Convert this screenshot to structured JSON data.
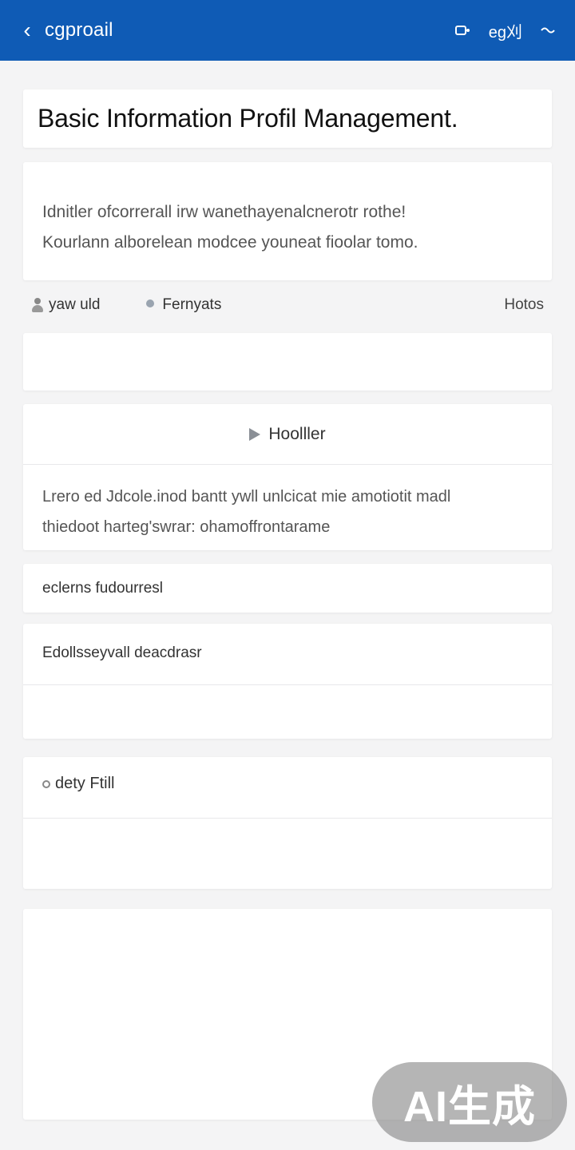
{
  "header": {
    "title": "cgproail",
    "action_label": "eg刈",
    "colors": {
      "background": "#0f5bb5",
      "text": "#ffffff"
    }
  },
  "page_title": "Basic Information Profil Management.",
  "intro": {
    "line1": "Idnitler ofcorrerall irw wanethayenalcnerotr rothe!",
    "line2": "Kourlann alborelean modcee youneat fioolar tomo."
  },
  "tabs": {
    "items": [
      {
        "label": "yaw uld",
        "icon": "person-icon"
      },
      {
        "label": "Fernyats",
        "icon": "dot-icon"
      }
    ],
    "right_label": "Hotos"
  },
  "header_section": {
    "title": "Hoolller",
    "line1": "Lrero ed Jdcole.inod bantt ywll unlcicat mie amotiotit madl",
    "line2": "thiedoot harteg'swrar: ohamoffrontarame"
  },
  "row": {
    "label": "eclerns fudourresl"
  },
  "section1": {
    "label": "Edollsseyvall deacdrasr"
  },
  "section2": {
    "label": "dety Ftill"
  },
  "badge": {
    "text": "AI生成"
  }
}
